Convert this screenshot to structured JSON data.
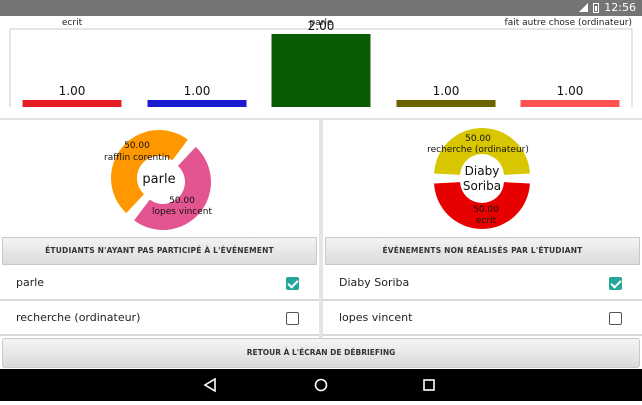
{
  "status": {
    "time": "12:56",
    "icons": [
      "wifi-icon",
      "battery-icon"
    ]
  },
  "chart_data": {
    "type": "bar",
    "categories": [
      "ecrit",
      "recherche (ordinateur)",
      "parle",
      "rafflin corentin",
      "fait autre chose (ordinateur)"
    ],
    "top_labels": [
      "ecrit",
      "parle",
      "fait autre chose (ordinateur)"
    ],
    "values": [
      1.0,
      1.0,
      2.0,
      1.0,
      1.0
    ],
    "value_labels": [
      "1.00",
      "1.00",
      "2.00",
      "1.00",
      "1.00"
    ],
    "colors": [
      "#e51c23",
      "#1a1ad1",
      "#0a5b04",
      "#6b6200",
      "#ff5252"
    ],
    "ylim": [
      0,
      2
    ]
  },
  "left_donut": {
    "center": "parle",
    "slices": [
      {
        "label": "rafflin corentin",
        "pct": "50.00",
        "value": 50,
        "color": "#ff9800"
      },
      {
        "label": "lopes vincent",
        "pct": "50.00",
        "value": 50,
        "color": "#e25591"
      }
    ]
  },
  "right_donut": {
    "center_line1": "Diaby",
    "center_line2": "Soriba",
    "slices": [
      {
        "label": "recherche (ordinateur)",
        "pct": "50.00",
        "value": 50,
        "color": "#d7c600"
      },
      {
        "label": "ecrit",
        "pct": "50.00",
        "value": 50,
        "color": "#e60000"
      }
    ]
  },
  "left_section": {
    "button": "ÉTUDIANTS N'AYANT PAS PARTICIPÉ À L'ÉVÉNEMENT",
    "items": [
      {
        "label": "parle",
        "checked": true
      },
      {
        "label": "recherche (ordinateur)",
        "checked": false
      }
    ]
  },
  "right_section": {
    "button": "ÉVÉNEMENTS NON RÉALISÉS PAR L'ÉTUDIANT",
    "items": [
      {
        "label": "Diaby Soriba",
        "checked": true
      },
      {
        "label": "lopes vincent",
        "checked": false
      }
    ]
  },
  "return_button": "RETOUR À L'ÉCRAN DE DÉBRIEFING",
  "nav": {
    "back": "back-icon",
    "home": "home-icon",
    "recents": "recents-icon"
  }
}
